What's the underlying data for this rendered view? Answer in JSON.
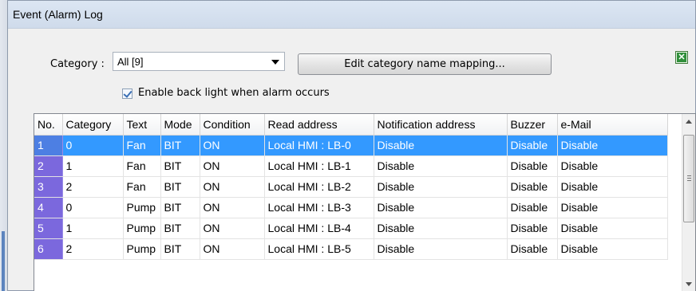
{
  "dialog": {
    "title": "Event (Alarm) Log"
  },
  "category": {
    "label": "Category :",
    "selected": "All [9]"
  },
  "edit_mapping_label": "Edit category name mapping...",
  "backlight": {
    "label": "Enable back light when alarm occurs",
    "checked": true
  },
  "table": {
    "columns": [
      "No.",
      "Category",
      "Text",
      "Mode",
      "Condition",
      "Read address",
      "Notification address",
      "Buzzer",
      "e-Mail"
    ],
    "rows": [
      {
        "no": "1",
        "category": "0",
        "text": "Fan",
        "mode": "BIT",
        "condition": "ON",
        "read_address": "Local HMI : LB-0",
        "notification": "Disable",
        "buzzer": "Disable",
        "email": "Disable"
      },
      {
        "no": "2",
        "category": "1",
        "text": "Fan",
        "mode": "BIT",
        "condition": "ON",
        "read_address": "Local HMI : LB-1",
        "notification": "Disable",
        "buzzer": "Disable",
        "email": "Disable"
      },
      {
        "no": "3",
        "category": "2",
        "text": "Fan",
        "mode": "BIT",
        "condition": "ON",
        "read_address": "Local HMI : LB-2",
        "notification": "Disable",
        "buzzer": "Disable",
        "email": "Disable"
      },
      {
        "no": "4",
        "category": "0",
        "text": "Pump",
        "mode": "BIT",
        "condition": "ON",
        "read_address": "Local HMI : LB-3",
        "notification": "Disable",
        "buzzer": "Disable",
        "email": "Disable"
      },
      {
        "no": "5",
        "category": "1",
        "text": "Pump",
        "mode": "BIT",
        "condition": "ON",
        "read_address": "Local HMI : LB-4",
        "notification": "Disable",
        "buzzer": "Disable",
        "email": "Disable"
      },
      {
        "no": "6",
        "category": "2",
        "text": "Pump",
        "mode": "BIT",
        "condition": "ON",
        "read_address": "Local HMI : LB-5",
        "notification": "Disable",
        "buzzer": "Disable",
        "email": "Disable"
      }
    ],
    "selected_row": "1"
  },
  "icons": {
    "export": "excel-icon"
  },
  "colors": {
    "selection": "#3399ff",
    "row_number_bg": "#7b68dd"
  }
}
